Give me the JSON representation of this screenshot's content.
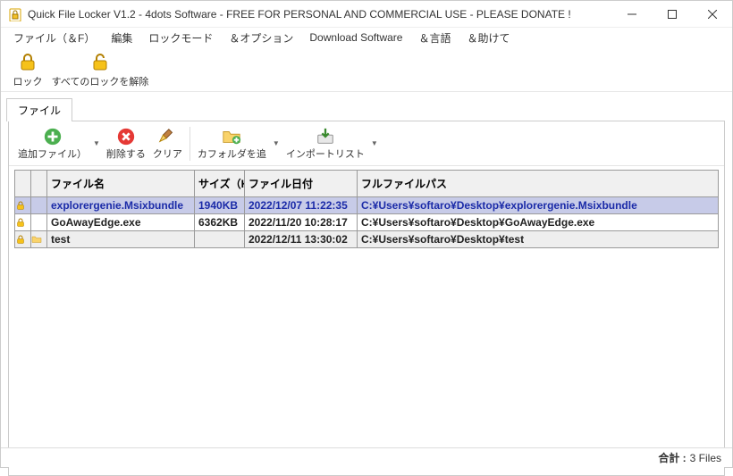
{
  "window": {
    "title": "Quick File Locker V1.2 - 4dots Software - FREE FOR PERSONAL AND COMMERCIAL USE - PLEASE DONATE !"
  },
  "menu": {
    "file": "ファイル（＆F）",
    "edit": "編集",
    "lockmode": "ロックモード",
    "options": "＆オプション",
    "download": "Download Software",
    "language": "＆言語",
    "help": "＆助けて"
  },
  "maintb": {
    "lock": "ロック",
    "unlock_all": "すべてのロックを解除"
  },
  "tab": {
    "files": "ファイル"
  },
  "actions": {
    "add_file": "追加ファイル）",
    "delete": "削除する",
    "clear": "クリア",
    "add_folder": "カフォルダを追",
    "import_list": "インポートリスト"
  },
  "columns": {
    "name": "ファイル名",
    "size": "サイズ（KB）",
    "date": "ファイル日付",
    "path": "フルファイルパス"
  },
  "rows": [
    {
      "selected": true,
      "folder": false,
      "name": "explorergenie.Msixbundle",
      "size": "1940KB",
      "date": "2022/12/07 11:22:35",
      "path": "C:¥Users¥softaro¥Desktop¥explorergenie.Msixbundle"
    },
    {
      "selected": false,
      "folder": false,
      "name": "GoAwayEdge.exe",
      "size": "6362KB",
      "date": "2022/11/20 10:28:17",
      "path": "C:¥Users¥softaro¥Desktop¥GoAwayEdge.exe"
    },
    {
      "selected": false,
      "folder": true,
      "name": "test",
      "size": "",
      "date": "2022/12/11 13:30:02",
      "path": "C:¥Users¥softaro¥Desktop¥test"
    }
  ],
  "status": {
    "total_label": "合計 :",
    "count": "3 Files"
  }
}
